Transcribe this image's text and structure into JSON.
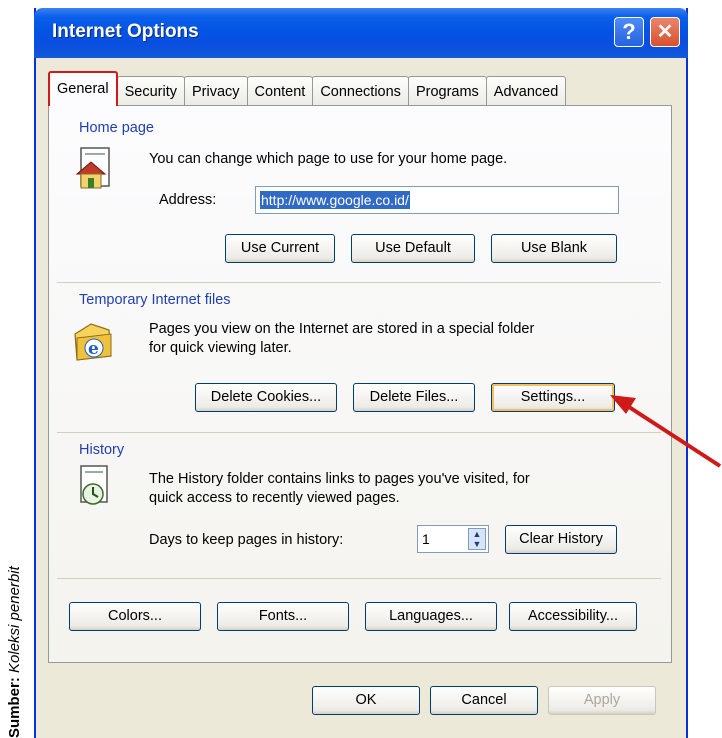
{
  "caption": {
    "label": "Sumber:",
    "text": "Koleksi penerbit"
  },
  "window": {
    "title": "Internet Options",
    "help_glyph": "?",
    "close_glyph": "✕"
  },
  "tabs": [
    {
      "label": "General",
      "active": true
    },
    {
      "label": "Security"
    },
    {
      "label": "Privacy"
    },
    {
      "label": "Content"
    },
    {
      "label": "Connections"
    },
    {
      "label": "Programs"
    },
    {
      "label": "Advanced"
    }
  ],
  "home_page": {
    "group_label": "Home page",
    "description": "You can change which page to use for your home page.",
    "address_label": "Address:",
    "address_value": "http://www.google.co.id/",
    "buttons": {
      "use_current": "Use Current",
      "use_default": "Use Default",
      "use_blank": "Use Blank"
    },
    "icon": "home-page-icon"
  },
  "temp_files": {
    "group_label": "Temporary Internet files",
    "description_line1": "Pages you view on the Internet are stored in a special folder",
    "description_line2": "for quick viewing later.",
    "buttons": {
      "delete_cookies": "Delete Cookies...",
      "delete_files": "Delete Files...",
      "settings": "Settings..."
    },
    "icon": "ie-folder-icon"
  },
  "history": {
    "group_label": "History",
    "description_line1": "The History folder contains links to pages you've visited, for",
    "description_line2": "quick access to recently viewed pages.",
    "days_label": "Days to keep pages in history:",
    "days_value": "1",
    "clear_button": "Clear History",
    "icon": "history-icon"
  },
  "bottom_buttons": {
    "colors": "Colors...",
    "fonts": "Fonts...",
    "languages": "Languages...",
    "accessibility": "Accessibility..."
  },
  "dialog_buttons": {
    "ok": "OK",
    "cancel": "Cancel",
    "apply": "Apply"
  },
  "colors": {
    "title_bar": "#0454e3",
    "dialog_bg": "#ece9d8",
    "group_label": "#1f3fb3",
    "highlight": "#d01a1a",
    "selection": "#316ac5"
  },
  "annotation": {
    "icon": "red-arrow-icon",
    "points_to": "Settings..."
  }
}
